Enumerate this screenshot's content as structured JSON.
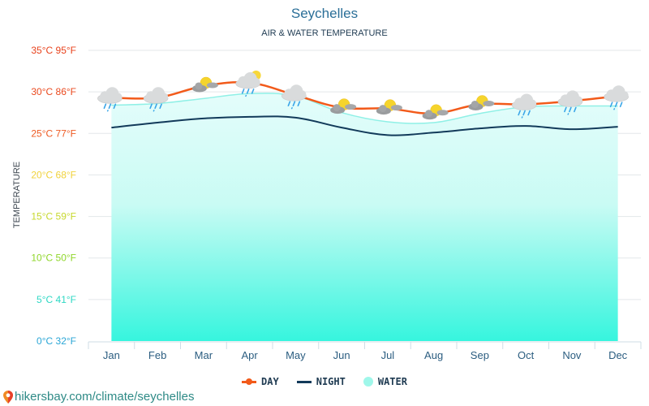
{
  "header": {
    "title": "Seychelles",
    "subtitle": "AIR & WATER TEMPERATURE"
  },
  "footer": {
    "source_text": "hikersbay.com/climate/seychelles",
    "source_icon": "map-pin-icon"
  },
  "legend": {
    "items": [
      {
        "label": "DAY",
        "color": "#f25a1a"
      },
      {
        "label": "NIGHT",
        "color": "#123a5a"
      },
      {
        "label": "WATER",
        "color": "#9ff7ea"
      }
    ]
  },
  "chart_data": {
    "type": "line",
    "title": "Seychelles",
    "subtitle": "AIR & WATER TEMPERATURE",
    "xlabel": "",
    "ylabel": "TEMPERATURE",
    "categories": [
      "Jan",
      "Feb",
      "Mar",
      "Apr",
      "May",
      "Jun",
      "Jul",
      "Aug",
      "Sep",
      "Oct",
      "Nov",
      "Dec"
    ],
    "ylim": [
      0,
      35
    ],
    "yticks": [
      {
        "value": 35,
        "label": "35°C 95°F",
        "color": "#e8421c"
      },
      {
        "value": 30,
        "label": "30°C 86°F",
        "color": "#ea4a1f"
      },
      {
        "value": 25,
        "label": "25°C 77°F",
        "color": "#ee5a22"
      },
      {
        "value": 20,
        "label": "20°C 68°F",
        "color": "#f0d23a"
      },
      {
        "value": 15,
        "label": "15°C 59°F",
        "color": "#c7d82e"
      },
      {
        "value": 10,
        "label": "10°C 50°F",
        "color": "#8fd62a"
      },
      {
        "value": 5,
        "label": "5°C 41°F",
        "color": "#2ed8c4"
      },
      {
        "value": 0,
        "label": "0°C 32°F",
        "color": "#2aa6d6"
      }
    ],
    "grid": true,
    "legend_position": "bottom-center",
    "series": [
      {
        "name": "DAY",
        "type": "line-markers",
        "color": "#f25a1a",
        "values": [
          29.3,
          29.3,
          30.7,
          31.1,
          29.6,
          28.1,
          28.0,
          27.4,
          28.5,
          28.5,
          28.9,
          29.5
        ]
      },
      {
        "name": "NIGHT",
        "type": "line",
        "color": "#123a5a",
        "values": [
          25.7,
          26.3,
          26.8,
          27.0,
          26.9,
          25.7,
          24.8,
          25.1,
          25.6,
          25.9,
          25.5,
          25.8
        ]
      },
      {
        "name": "WATER",
        "type": "area",
        "color": "#9ff7ea",
        "values": [
          28.4,
          28.6,
          29.2,
          29.8,
          29.5,
          27.5,
          26.4,
          26.3,
          27.4,
          28.2,
          28.3,
          28.3
        ]
      }
    ],
    "weather_icons": [
      "cloud-rain",
      "cloud-rain",
      "partly-sunny",
      "cloud-rain-sun",
      "cloud-rain",
      "partly-sunny",
      "partly-sunny",
      "partly-sunny",
      "partly-sunny",
      "cloud-rain",
      "cloud-rain",
      "cloud-rain"
    ]
  }
}
